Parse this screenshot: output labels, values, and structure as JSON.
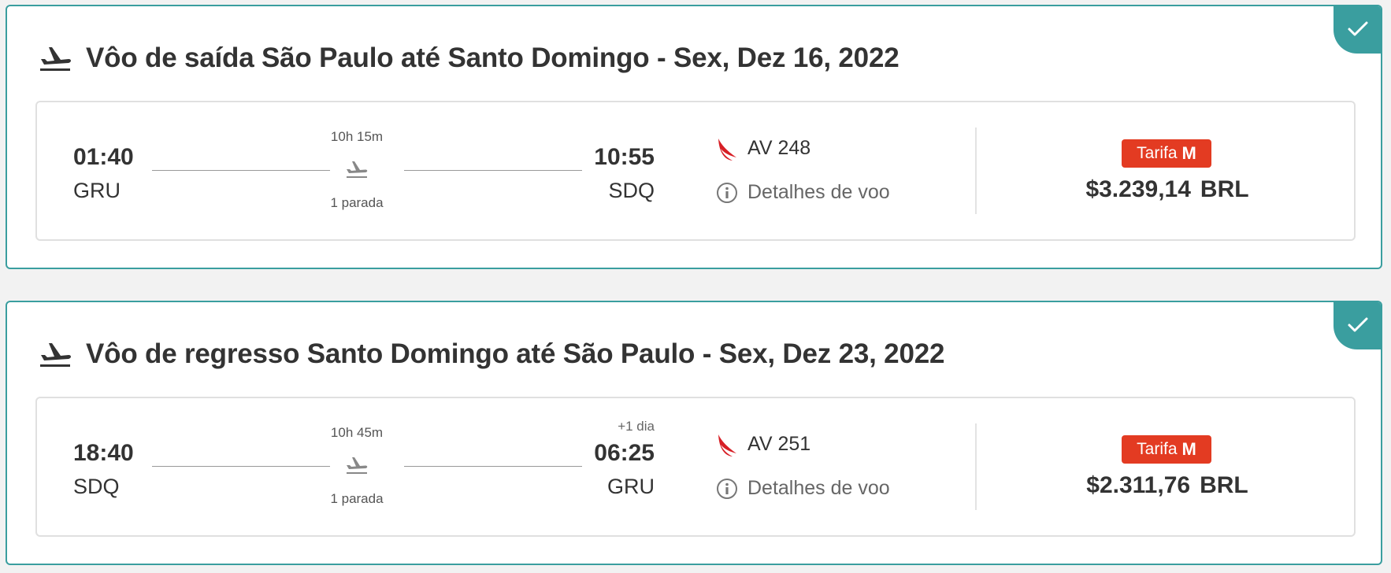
{
  "colors": {
    "accent": "#3a9e9f",
    "fare_badge": "#e33b22",
    "airline_logo": "#d71f26"
  },
  "flights": [
    {
      "title": "Vôo de saída São Paulo até Santo Domingo - Sex, Dez 16, 2022",
      "header_icon": "plane-departure-icon",
      "departure_time": "01:40",
      "departure_code": "GRU",
      "arrival_time": "10:55",
      "arrival_code": "SDQ",
      "next_day": "",
      "duration": "10h 15m",
      "stops": "1 parada",
      "flight_number": "AV 248",
      "details_label": "Detalhes de voo",
      "fare_label": "Tarifa",
      "fare_class": "M",
      "price": "$3.239,14",
      "currency": "BRL"
    },
    {
      "title": "Vôo de regresso Santo Domingo até São Paulo - Sex, Dez 23, 2022",
      "header_icon": "plane-departure-icon",
      "departure_time": "18:40",
      "departure_code": "SDQ",
      "arrival_time": "06:25",
      "arrival_code": "GRU",
      "next_day": "+1 dia",
      "duration": "10h 45m",
      "stops": "1 parada",
      "flight_number": "AV 251",
      "details_label": "Detalhes de voo",
      "fare_label": "Tarifa",
      "fare_class": "M",
      "price": "$2.311,76",
      "currency": "BRL"
    }
  ]
}
